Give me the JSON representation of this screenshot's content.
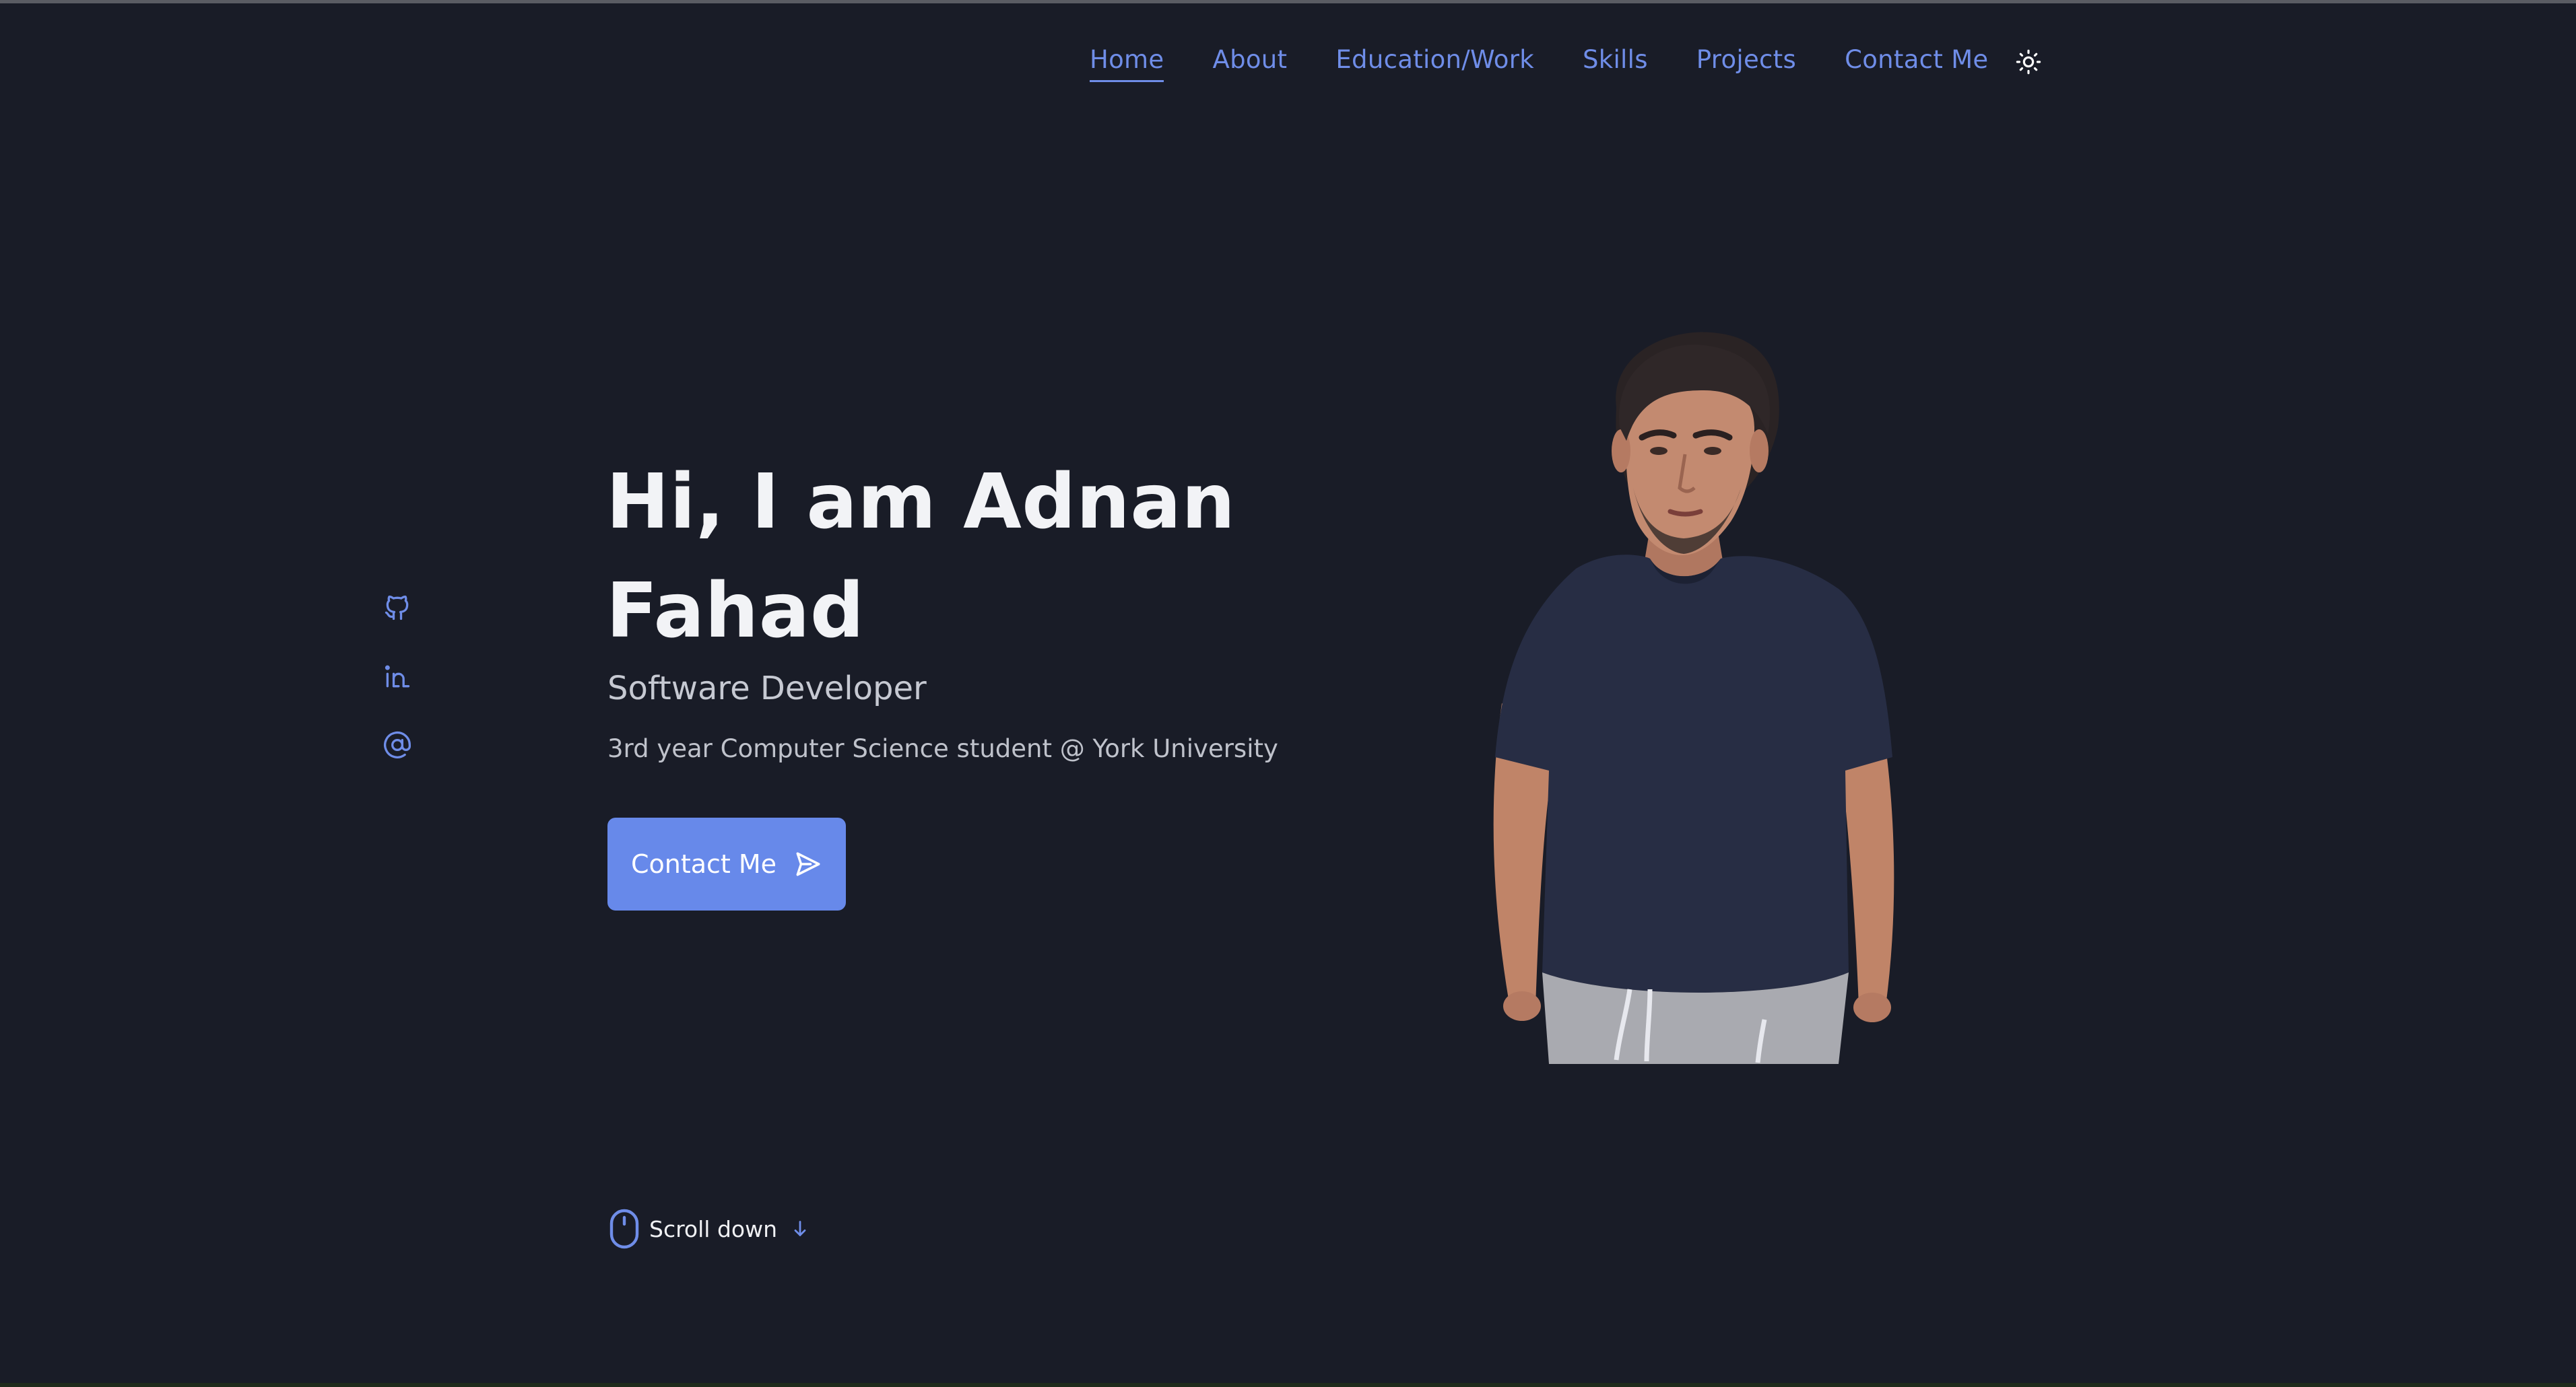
{
  "nav": {
    "items": [
      {
        "label": "Home"
      },
      {
        "label": "About"
      },
      {
        "label": "Education/Work"
      },
      {
        "label": "Skills"
      },
      {
        "label": "Projects"
      },
      {
        "label": "Contact Me"
      }
    ],
    "active_index": 0,
    "theme_toggle_icon": "sun-icon"
  },
  "social": {
    "icons": [
      "github-icon",
      "linkedin-icon",
      "at-sign-icon"
    ]
  },
  "hero": {
    "title": "Hi, I am Adnan Fahad",
    "subtitle": "Software Developer",
    "description": "3rd year Computer Science student @ York University",
    "button_label": "Contact Me",
    "button_icon": "send-icon"
  },
  "scroll": {
    "label": "Scroll down",
    "mouse_icon": "mouse-icon",
    "arrow_icon": "arrow-down-icon"
  },
  "colors": {
    "background": "#191c27",
    "accent": "#6789ea",
    "nav_link": "#6f8de8",
    "heading": "#f2f3f6",
    "text": "#bfc2cb"
  }
}
